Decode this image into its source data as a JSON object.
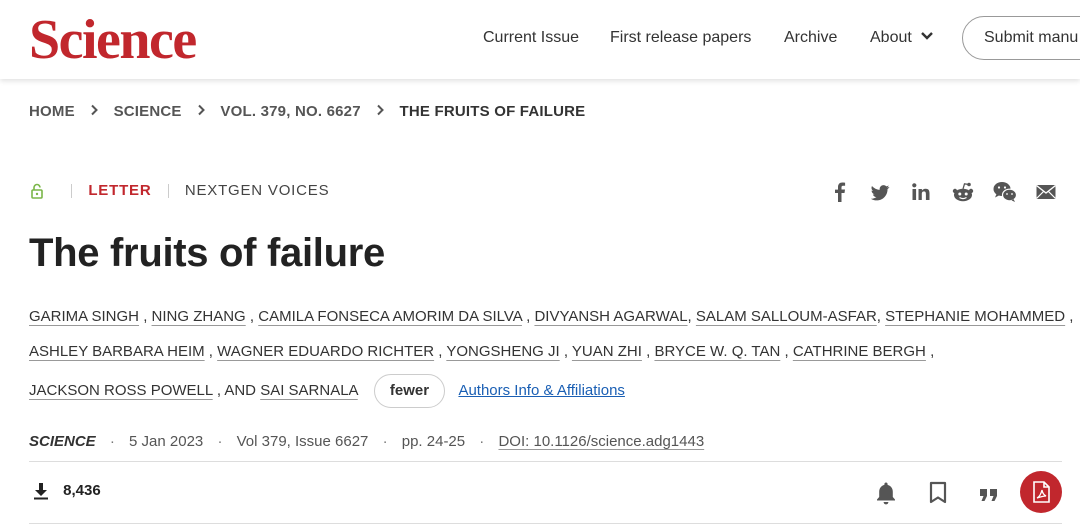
{
  "header": {
    "logo": "Science",
    "nav": [
      "Current Issue",
      "First release papers",
      "Archive",
      "About"
    ],
    "submit_label": "Submit manu"
  },
  "breadcrumb": [
    "HOME",
    "SCIENCE",
    "VOL. 379, NO. 6627",
    "THE FRUITS OF FAILURE"
  ],
  "article": {
    "type": "LETTER",
    "section": "NEXTGEN VOICES",
    "title": "The fruits of failure",
    "authors": [
      "GARIMA SINGH",
      "NING ZHANG",
      "CAMILA FONSECA AMORIM DA SILVA",
      "DIVYANSH AGARWAL",
      "SALAM SALLOUM-ASFAR",
      "STEPHANIE MOHAMMED",
      "ASHLEY BARBARA HEIM",
      "WAGNER EDUARDO RICHTER",
      "YONGSHENG JI",
      "YUAN ZHI",
      "BRYCE W. Q. TAN",
      "CATHRINE BERGH",
      "JACKSON ROSS POWELL",
      "SAI SARNALA"
    ],
    "and_text": ", AND",
    "fewer_label": "fewer",
    "affiliations_label": "Authors Info & Affiliations",
    "journal": "SCIENCE",
    "date": "5 Jan 2023",
    "volume": "Vol 379, Issue 6627",
    "pages": "pp. 24-25",
    "doi": "DOI: 10.1126/science.adg1443",
    "downloads": "8,436"
  },
  "share_icons": [
    "facebook-icon",
    "twitter-icon",
    "linkedin-icon",
    "reddit-icon",
    "wechat-icon",
    "email-icon"
  ],
  "actions": [
    "bell-icon",
    "bookmark-icon",
    "quote-icon",
    "pdf-icon"
  ],
  "colors": {
    "brand": "#c1272d",
    "link": "#1a5fb4",
    "lock": "#7ab648"
  }
}
